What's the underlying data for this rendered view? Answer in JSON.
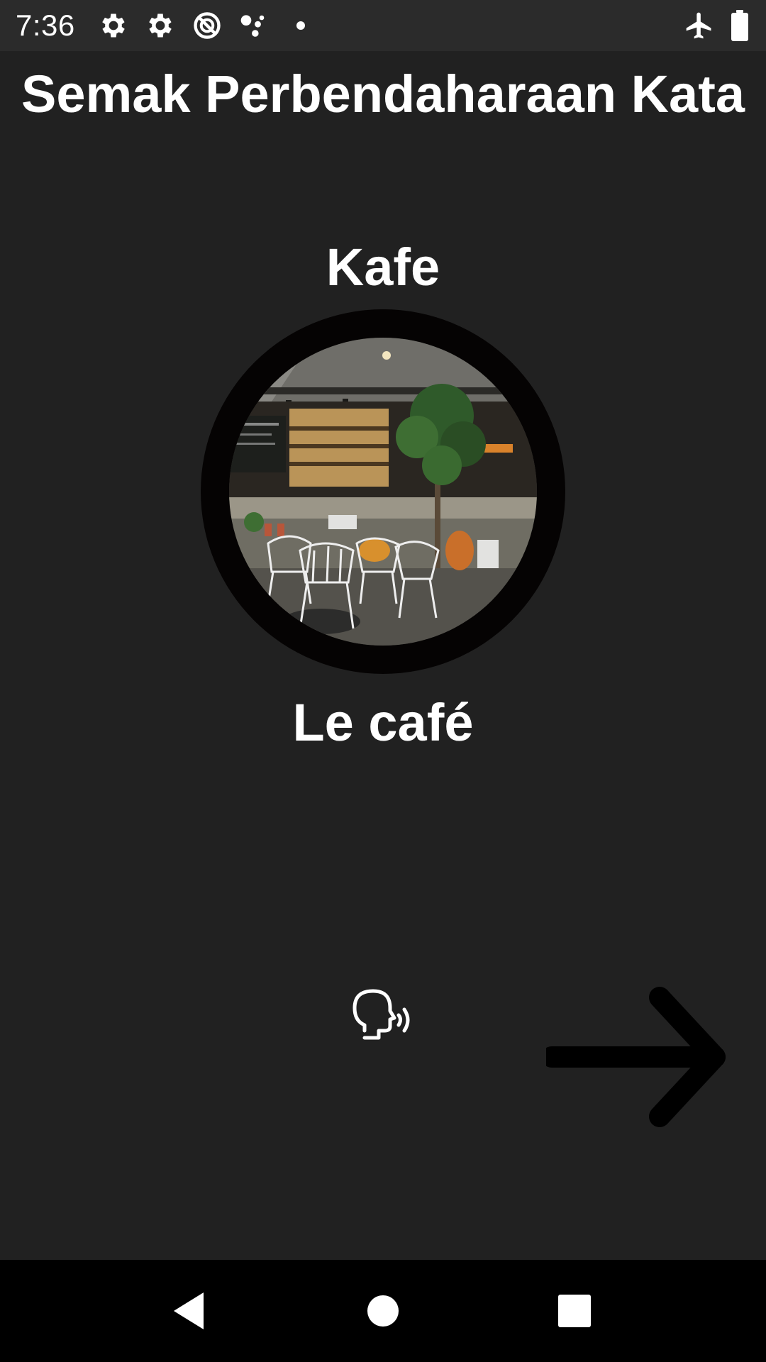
{
  "status_bar": {
    "time": "7:36",
    "left_icons": [
      "settings-icon",
      "settings-icon",
      "data-saver-icon",
      "assistant-dots-icon",
      "notification-dot-icon"
    ],
    "right_icons": [
      "airplane-mode-icon",
      "battery-icon"
    ]
  },
  "screen": {
    "title": "Semak Perbendaharaan Kata",
    "word_native": "Kafe",
    "word_target": "Le café",
    "image_subject": "cafe interior photo",
    "speak_icon": "speak-voice-icon",
    "next_icon": "arrow-right-icon"
  },
  "nav_bar": {
    "buttons": [
      "back-icon",
      "home-icon",
      "recents-icon"
    ]
  }
}
